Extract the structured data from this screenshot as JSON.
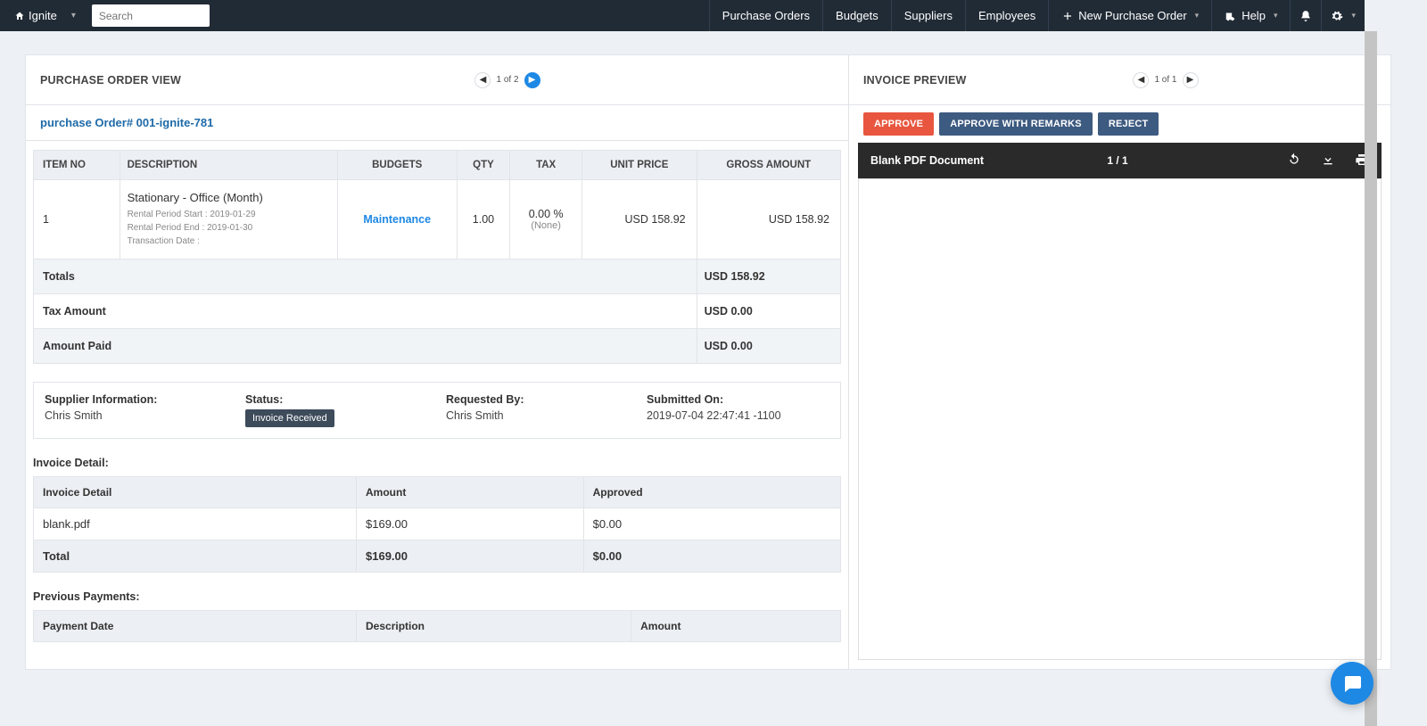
{
  "brand": {
    "name": "Ignite"
  },
  "search": {
    "placeholder": "Search"
  },
  "nav": {
    "purchase_orders": "Purchase Orders",
    "budgets": "Budgets",
    "suppliers": "Suppliers",
    "employees": "Employees",
    "new_po": "New Purchase Order",
    "help": "Help"
  },
  "po_view": {
    "title": "PURCHASE ORDER VIEW",
    "pager": "1 of 2",
    "po_number": "purchase Order# 001-ignite-781",
    "headers": {
      "item_no": "ITEM NO",
      "description": "DESCRIPTION",
      "budgets": "BUDGETS",
      "qty": "QTY",
      "tax": "TAX",
      "unit_price": "UNIT PRICE",
      "gross_amount": "GROSS AMOUNT"
    },
    "row": {
      "item_no": "1",
      "desc_main": "Stationary - Office (Month)",
      "desc_l1": "Rental Period Start : 2019-01-29",
      "desc_l2": "Rental Period End : 2019-01-30",
      "desc_l3": "Transaction Date :",
      "budget": "Maintenance",
      "qty": "1.00",
      "tax_pct": "0.00 %",
      "tax_none": "(None)",
      "unit_price": "USD 158.92",
      "gross": "USD 158.92"
    },
    "totals": {
      "label_totals": "Totals",
      "val_totals": "USD 158.92",
      "label_tax": "Tax Amount",
      "val_tax": "USD 0.00",
      "label_paid": "Amount Paid",
      "val_paid": "USD 0.00"
    }
  },
  "info": {
    "supplier_label": "Supplier Information:",
    "supplier_val": "Chris Smith",
    "status_label": "Status:",
    "status_val": "Invoice Received",
    "requested_label": "Requested By:",
    "requested_val": "Chris Smith",
    "submitted_label": "Submitted On:",
    "submitted_val": "2019-07-04 22:47:41 -1100"
  },
  "invoice_detail": {
    "heading": "Invoice Detail:",
    "cols": {
      "c1": "Invoice Detail",
      "c2": "Amount",
      "c3": "Approved"
    },
    "row": {
      "name": "blank.pdf",
      "amount": "$169.00",
      "approved": "$0.00"
    },
    "total_row": {
      "label": "Total",
      "amount": "$169.00",
      "approved": "$0.00"
    }
  },
  "payments": {
    "heading": "Previous Payments:",
    "cols": {
      "c1": "Payment Date",
      "c2": "Description",
      "c3": "Amount"
    }
  },
  "preview": {
    "title": "INVOICE PREVIEW",
    "pager": "1 of 1",
    "approve": "APPROVE",
    "approve_remarks": "APPROVE WITH REMARKS",
    "reject": "REJECT",
    "pdf_name": "Blank PDF Document",
    "pdf_page": "1 / 1"
  }
}
